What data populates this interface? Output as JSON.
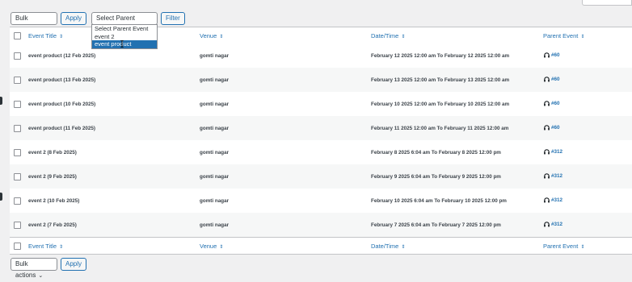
{
  "toolbar_top": {
    "bulk_actions": "Bulk actions",
    "apply": "Apply",
    "parent_event_select": "Select Parent Event",
    "filter": "Filter"
  },
  "parent_event_dropdown": {
    "options": [
      "Select Parent Event",
      "event 2",
      "event product"
    ],
    "highlighted": "event product"
  },
  "columns": {
    "event_title": "Event Title",
    "venue": "Venue",
    "date_time": "Date/Time",
    "parent_event": "Parent Event",
    "sort_glyph": "⇕"
  },
  "rows": [
    {
      "title": "event product (12 Feb 2025)",
      "venue": "gomti nagar",
      "datetime": "February 12 2025 12:00 am To February 12 2025 12:00 am",
      "parent": "#60"
    },
    {
      "title": "event product (13 Feb 2025)",
      "venue": "gomti nagar",
      "datetime": "February 13 2025 12:00 am To February 13 2025 12:00 am",
      "parent": "#60"
    },
    {
      "title": "event product (10 Feb 2025)",
      "venue": "gomti nagar",
      "datetime": "February 10 2025 12:00 am To February 10 2025 12:00 am",
      "parent": "#60"
    },
    {
      "title": "event product (11 Feb 2025)",
      "venue": "gomti nagar",
      "datetime": "February 11 2025 12:00 am To February 11 2025 12:00 am",
      "parent": "#60"
    },
    {
      "title": "event 2 (8 Feb 2025)",
      "venue": "gomti nagar",
      "datetime": "February 8 2025 6:04 am To February 8 2025 12:00 pm",
      "parent": "#312"
    },
    {
      "title": "event 2 (9 Feb 2025)",
      "venue": "gomti nagar",
      "datetime": "February 9 2025 6:04 am To February 9 2025 12:00 pm",
      "parent": "#312"
    },
    {
      "title": "event 2 (10 Feb 2025)",
      "venue": "gomti nagar",
      "datetime": "February 10 2025 6:04 am To February 10 2025 12:00 pm",
      "parent": "#312"
    },
    {
      "title": "event 2 (7 Feb 2025)",
      "venue": "gomti nagar",
      "datetime": "February 7 2025 6:04 am To February 7 2025 12:00 pm",
      "parent": "#312"
    }
  ],
  "toolbar_bottom": {
    "bulk_actions": "Bulk actions",
    "apply": "Apply"
  },
  "colors": {
    "link": "#2271b1",
    "background": "#f0f0f1",
    "row_alt": "#f6f7f7"
  }
}
